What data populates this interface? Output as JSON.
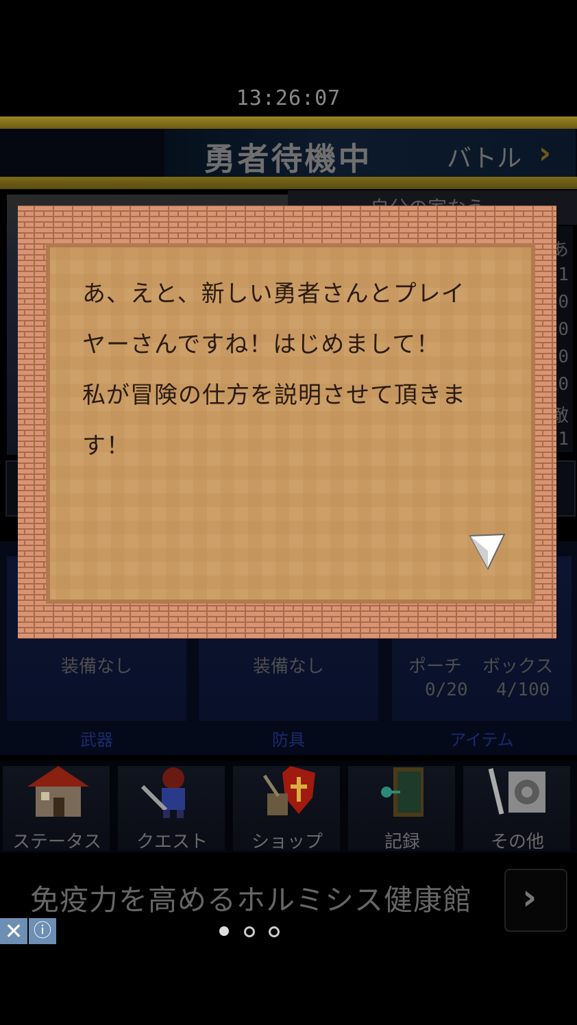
{
  "clock": "13:26:07",
  "header": {
    "title": "勇者待機中",
    "battle_label": "バトル",
    "battle_chevron": "›"
  },
  "location": "自分の家なう",
  "stats": [
    "あ",
    "1",
    "/50",
    "0",
    "20",
    "10",
    "敵",
    "1"
  ],
  "equipment": {
    "weapon_slot": "装備なし",
    "armor_slot": "装備なし",
    "pouch_label": "ポーチ",
    "pouch_count": "0/20",
    "box_label": "ボックス",
    "box_count": "4/100"
  },
  "tabs": [
    "武器",
    "防具",
    "アイテム"
  ],
  "nav": [
    {
      "label": "ステータス",
      "icon": "house-icon"
    },
    {
      "label": "クエスト",
      "icon": "hero-icon"
    },
    {
      "label": "ショップ",
      "icon": "shield-shop-icon"
    },
    {
      "label": "記録",
      "icon": "book-icon"
    },
    {
      "label": "その他",
      "icon": "gear-icon"
    }
  ],
  "dialog": {
    "lines": [
      "あ、えと、新しい勇者さんとプレイ",
      "ヤーさんですね！はじめまして！",
      "私が冒険の仕方を説明させて頂きま",
      "す！"
    ],
    "next_icon": "next-arrow-icon"
  },
  "ad": {
    "text": "免疫力を高めるホルミシス健康館",
    "close": "✕",
    "info": "ⓘ",
    "chevron": "›"
  },
  "colors": {
    "parchment": "#c89a62",
    "border": "#d49070",
    "gold": "#9a8420"
  }
}
